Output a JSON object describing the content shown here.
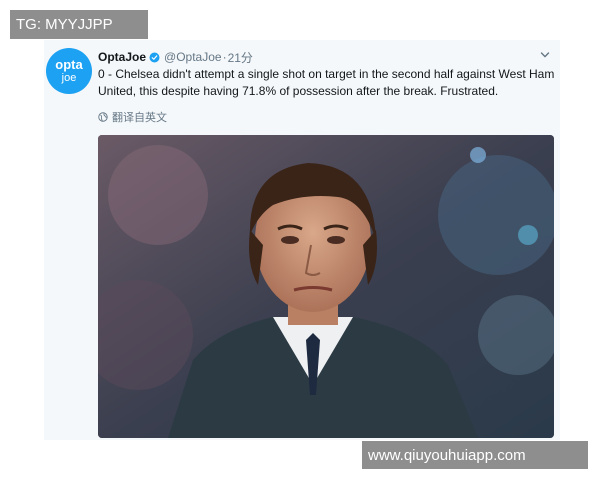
{
  "watermarks": {
    "top_left": "TG: MYYJJPP",
    "bottom_right": "www.qiuyouhuiapp.com"
  },
  "tweet": {
    "avatar": {
      "line1": "opta",
      "line2": "joe",
      "color": "#1da1f2"
    },
    "author_name": "OptaJoe",
    "verified_icon": "verified-badge-icon",
    "handle": "@OptaJoe",
    "separator": "·",
    "time": "21分",
    "text": "0 - Chelsea didn't attempt a single shot on target in the second half against West Ham United, this despite having 71.8% of possession after the break. Frustrated.",
    "translate_label": "翻译自英文",
    "menu_icon": "chevron-down-icon",
    "globe_icon": "globe-icon"
  },
  "colors": {
    "accent": "#1da1f2",
    "card_bg": "#f5f8fa",
    "text": "#14171a",
    "muted": "#657786",
    "watermark_bg": "#8e8e8e"
  }
}
